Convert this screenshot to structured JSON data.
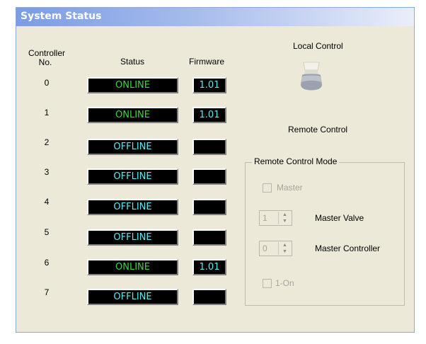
{
  "panel": {
    "title": "System Status"
  },
  "columns": {
    "controller_no": "Controller\nNo.",
    "status": "Status",
    "firmware": "Firmware"
  },
  "controllers": [
    {
      "no": "0",
      "status": "ONLINE",
      "firmware": "1.01"
    },
    {
      "no": "1",
      "status": "ONLINE",
      "firmware": "1.01"
    },
    {
      "no": "2",
      "status": "OFFLINE",
      "firmware": ""
    },
    {
      "no": "3",
      "status": "OFFLINE",
      "firmware": ""
    },
    {
      "no": "4",
      "status": "OFFLINE",
      "firmware": ""
    },
    {
      "no": "5",
      "status": "OFFLINE",
      "firmware": ""
    },
    {
      "no": "6",
      "status": "ONLINE",
      "firmware": "1.01"
    },
    {
      "no": "7",
      "status": "OFFLINE",
      "firmware": ""
    }
  ],
  "control": {
    "local_label": "Local Control",
    "remote_label": "Remote Control",
    "toggle_icon": "toggle-switch-icon"
  },
  "remote_mode": {
    "title": "Remote Control Mode",
    "master_label": "Master",
    "master_checked": false,
    "master_valve_value": "1",
    "master_valve_label": "Master Valve",
    "master_controller_value": "0",
    "master_controller_label": "Master Controller",
    "one_on_label": "1-On",
    "one_on_checked": false
  },
  "colors": {
    "online": "#3cd63c",
    "offline": "#5fe9ef",
    "panel_bg": "#ece9d8",
    "title_gradient_start": "#7b9ce4"
  }
}
